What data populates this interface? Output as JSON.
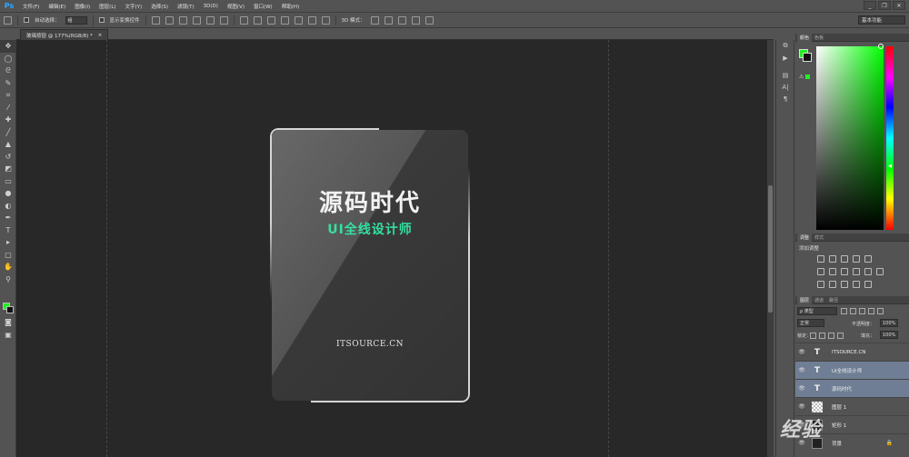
{
  "app": {
    "logo": "Ps"
  },
  "menu": [
    "文件(F)",
    "编辑(E)",
    "图像(I)",
    "图层(L)",
    "文字(Y)",
    "选择(S)",
    "滤镜(T)",
    "3D(D)",
    "视图(V)",
    "窗口(W)",
    "帮助(H)"
  ],
  "window_controls": {
    "minimize": "_",
    "restore": "❐",
    "close": "✕"
  },
  "options": {
    "auto_select_label": "自动选择：",
    "auto_select_value": "组",
    "show_transform_label": "显示变换控件",
    "mode_3d_label": "3D 模式：",
    "workspace": "基本功能"
  },
  "document": {
    "tab_title": "玻璃按钮 @ 177%(RGB/8) *",
    "tab_close": "×"
  },
  "canvas": {
    "title": "源码时代",
    "subtitle": "UI全线设计师",
    "footer": "ITSOURCE.CN",
    "subtitle_color": "#33e0a0"
  },
  "color_panel": {
    "tabs": [
      "颜色",
      "色板"
    ],
    "foreground": "#22ee22",
    "background": "#111111"
  },
  "adjust_panel": {
    "tabs": [
      "调整",
      "样式"
    ],
    "label": "添加调整"
  },
  "layers_panel": {
    "tabs": [
      "图层",
      "通道",
      "路径"
    ],
    "filter": "ρ 类型",
    "blend_mode": "正常",
    "opacity_label": "不透明度：",
    "opacity_value": "100%",
    "lock_label": "锁定：",
    "fill_label": "填充：",
    "fill_value": "100%",
    "layers": [
      {
        "name": "ITSOURCE.CN",
        "type": "T",
        "selected": false
      },
      {
        "name": "UI全线设计师",
        "type": "T",
        "selected": true
      },
      {
        "name": "源码时代",
        "type": "T",
        "selected": true
      },
      {
        "name": "图层 1",
        "type": "checker",
        "selected": false
      },
      {
        "name": "矩形 1",
        "type": "dark",
        "selected": false
      },
      {
        "name": "背景",
        "type": "dark",
        "selected": false
      }
    ],
    "lock_icon": "🔒"
  },
  "watermark": "经验"
}
